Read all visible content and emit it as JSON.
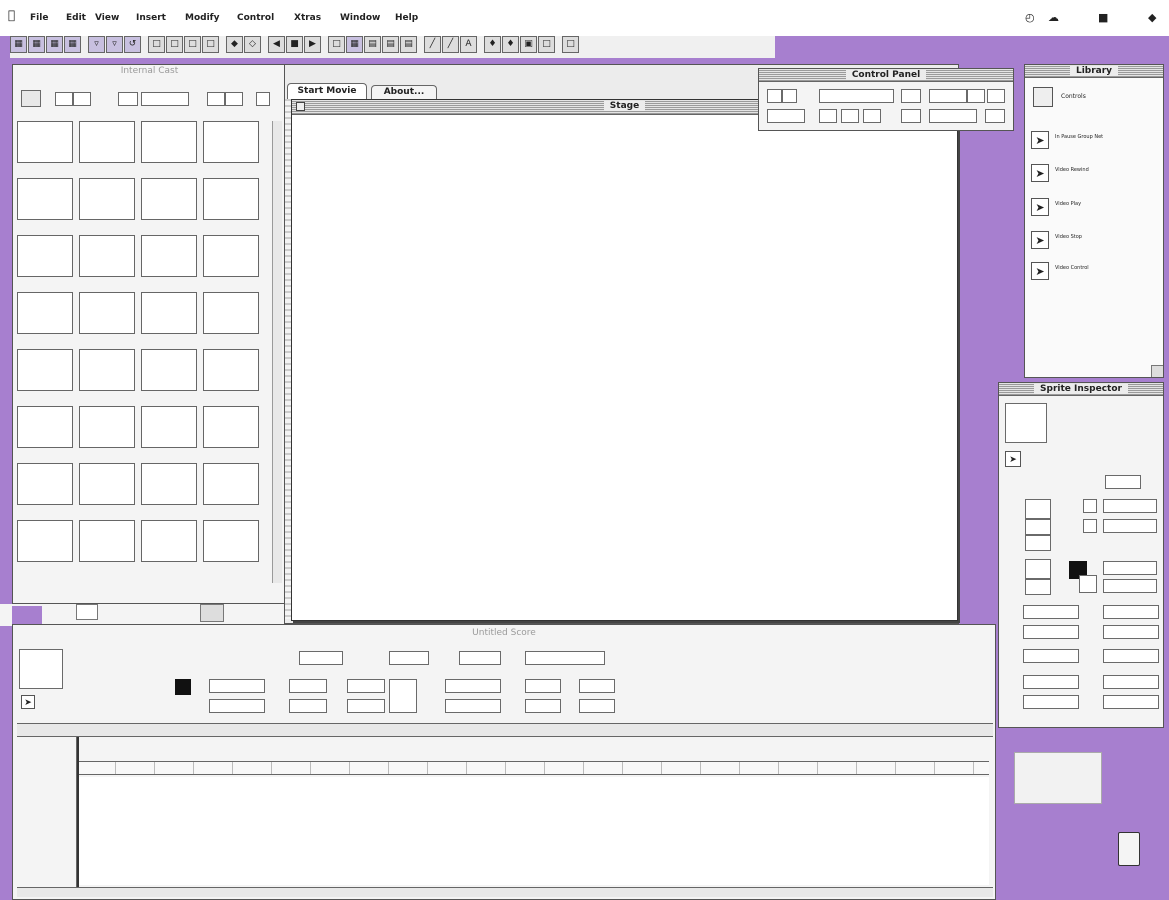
{
  "menubar": {
    "items": [
      "File",
      "Edit",
      "View",
      "Insert",
      "Modify",
      "Control",
      "Xtras",
      "Window",
      "Help"
    ]
  },
  "stage": {
    "title": "Stage",
    "tabs": [
      "Start Movie",
      "About..."
    ]
  },
  "cast_window": {
    "title": "Internal Cast"
  },
  "control_panel": {
    "title": "Control Panel"
  },
  "library": {
    "title": "Library",
    "items": [
      "Controls",
      "In Pause Group Net",
      "Video Rewind",
      "Video Play",
      "Video Stop",
      "Video Control"
    ]
  },
  "sprite_inspector": {
    "title": "Sprite Inspector"
  },
  "score": {
    "title": "Untitled Score"
  },
  "colors": {
    "desktop": "#a77fcf",
    "window": "#f4f4f4"
  }
}
